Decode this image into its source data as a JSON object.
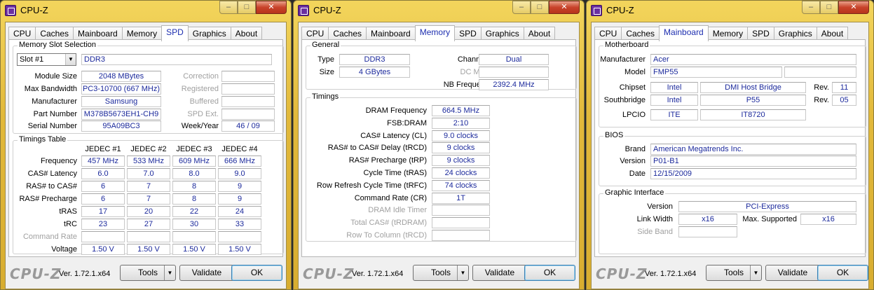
{
  "windows": [
    {
      "title": "CPU-Z",
      "tabs": [
        "CPU",
        "Caches",
        "Mainboard",
        "Memory",
        "SPD",
        "Graphics",
        "About"
      ],
      "active_tab": "SPD",
      "slot_group": "Memory Slot Selection",
      "slot": "Slot #1",
      "slot_type": "DDR3",
      "left_rows": [
        {
          "label": "Module Size",
          "value": "2048 MBytes"
        },
        {
          "label": "Max Bandwidth",
          "value": "PC3-10700 (667 MHz)"
        },
        {
          "label": "Manufacturer",
          "value": "Samsung"
        },
        {
          "label": "Part Number",
          "value": "M378B5673EH1-CH9"
        },
        {
          "label": "Serial Number",
          "value": "95A09BC3"
        }
      ],
      "right_rows": [
        {
          "label": "Correction",
          "value": ""
        },
        {
          "label": "Registered",
          "value": ""
        },
        {
          "label": "Buffered",
          "value": ""
        },
        {
          "label": "SPD Ext.",
          "value": ""
        },
        {
          "label": "Week/Year",
          "value": "46 / 09"
        }
      ],
      "timings_group": "Timings Table",
      "timing_headers": [
        "JEDEC #1",
        "JEDEC #2",
        "JEDEC #3",
        "JEDEC #4"
      ],
      "timing_rows": [
        {
          "label": "Frequency",
          "values": [
            "457 MHz",
            "533 MHz",
            "609 MHz",
            "666 MHz"
          ]
        },
        {
          "label": "CAS# Latency",
          "values": [
            "6.0",
            "7.0",
            "8.0",
            "9.0"
          ]
        },
        {
          "label": "RAS# to CAS#",
          "values": [
            "6",
            "7",
            "8",
            "9"
          ]
        },
        {
          "label": "RAS# Precharge",
          "values": [
            "6",
            "7",
            "8",
            "9"
          ]
        },
        {
          "label": "tRAS",
          "values": [
            "17",
            "20",
            "22",
            "24"
          ]
        },
        {
          "label": "tRC",
          "values": [
            "23",
            "27",
            "30",
            "33"
          ]
        },
        {
          "label": "Command Rate",
          "values": [
            "",
            "",
            "",
            ""
          ]
        },
        {
          "label": "Voltage",
          "values": [
            "1.50 V",
            "1.50 V",
            "1.50 V",
            "1.50 V"
          ]
        }
      ],
      "logo": "CPU-Z",
      "version": "Ver. 1.72.1.x64",
      "tools_label": "Tools",
      "validate_label": "Validate",
      "ok_label": "OK"
    },
    {
      "title": "CPU-Z",
      "tabs": [
        "CPU",
        "Caches",
        "Mainboard",
        "Memory",
        "SPD",
        "Graphics",
        "About"
      ],
      "active_tab": "Memory",
      "general_group": "General",
      "type_label": "Type",
      "type_value": "DDR3",
      "size_label": "Size",
      "size_value": "4 GBytes",
      "channel_label": "Channel #",
      "channel_value": "Dual",
      "dcmode_label": "DC Mode",
      "dcmode_value": "",
      "nbfreq_label": "NB Frequency",
      "nbfreq_value": "2392.4 MHz",
      "timings_group": "Timings",
      "timing_rows": [
        {
          "label": "DRAM Frequency",
          "value": "664.5 MHz"
        },
        {
          "label": "FSB:DRAM",
          "value": "2:10"
        },
        {
          "label": "CAS# Latency (CL)",
          "value": "9.0 clocks"
        },
        {
          "label": "RAS# to CAS# Delay (tRCD)",
          "value": "9 clocks"
        },
        {
          "label": "RAS# Precharge (tRP)",
          "value": "9 clocks"
        },
        {
          "label": "Cycle Time (tRAS)",
          "value": "24 clocks"
        },
        {
          "label": "Row Refresh Cycle Time (tRFC)",
          "value": "74 clocks"
        },
        {
          "label": "Command Rate (CR)",
          "value": "1T"
        },
        {
          "label": "DRAM Idle Timer",
          "value": ""
        },
        {
          "label": "Total CAS# (tRDRAM)",
          "value": ""
        },
        {
          "label": "Row To Column (tRCD)",
          "value": ""
        }
      ],
      "logo": "CPU-Z",
      "version": "Ver. 1.72.1.x64",
      "tools_label": "Tools",
      "validate_label": "Validate",
      "ok_label": "OK"
    },
    {
      "title": "CPU-Z",
      "tabs": [
        "CPU",
        "Caches",
        "Mainboard",
        "Memory",
        "SPD",
        "Graphics",
        "About"
      ],
      "active_tab": "Mainboard",
      "mb_group": "Motherboard",
      "manufacturer_label": "Manufacturer",
      "manufacturer_value": "Acer",
      "model_label": "Model",
      "model_value": "FMP55",
      "model_extra": "",
      "chipset_label": "Chipset",
      "chipset_vendor": "Intel",
      "chipset_name": "DMI Host Bridge",
      "chipset_rev_label": "Rev.",
      "chipset_rev": "11",
      "south_label": "Southbridge",
      "south_vendor": "Intel",
      "south_name": "P55",
      "south_rev_label": "Rev.",
      "south_rev": "05",
      "lpcio_label": "LPCIO",
      "lpcio_vendor": "ITE",
      "lpcio_name": "IT8720",
      "bios_group": "BIOS",
      "brand_label": "Brand",
      "brand_value": "American Megatrends Inc.",
      "bversion_label": "Version",
      "bversion_value": "P01-B1",
      "date_label": "Date",
      "date_value": "12/15/2009",
      "gi_group": "Graphic Interface",
      "gversion_label": "Version",
      "gversion_value": "PCI-Express",
      "lw_label": "Link Width",
      "lw_value": "x16",
      "maxsup_label": "Max. Supported",
      "maxsup_value": "x16",
      "sideband_label": "Side Band",
      "sideband_value": "",
      "logo": "CPU-Z",
      "version": "Ver. 1.72.1.x64",
      "tools_label": "Tools",
      "validate_label": "Validate",
      "ok_label": "OK"
    }
  ],
  "window_controls": {
    "minimize": "–",
    "maximize": "□",
    "close": "✕"
  }
}
